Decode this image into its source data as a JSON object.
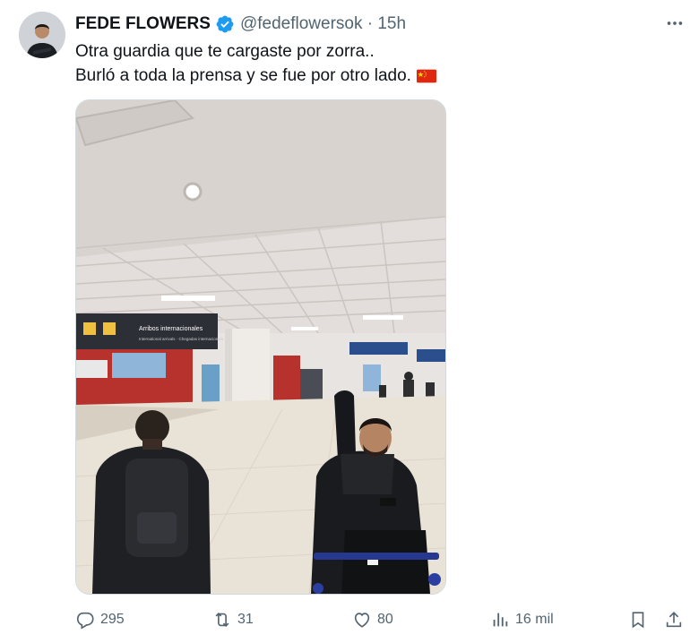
{
  "user": {
    "name": "FEDE FLOWERS",
    "handle_time": "@fedeflowersok · 15h"
  },
  "tweet": {
    "line1": "Otra guardia que te cargaste por zorra..",
    "line2": "Burló a toda la prensa y se fue por otro lado."
  },
  "media": {
    "sign_main": "Arribos internacionales",
    "sign_sub": "International arrivals · Chegadas internacionais"
  },
  "actions": {
    "replies": "295",
    "reposts": "31",
    "likes": "80",
    "views": "16 mil"
  },
  "icons": {
    "verified": "verified-badge-icon",
    "more": "more-dots-icon",
    "reply": "reply-icon",
    "repost": "repost-icon",
    "like": "heart-icon",
    "views": "views-chart-icon",
    "bookmark": "bookmark-icon",
    "share": "share-icon",
    "flag": "china-flag-icon"
  },
  "colors": {
    "verified": "#1d9bf0",
    "text": "#0f1419",
    "muted": "#536471"
  }
}
